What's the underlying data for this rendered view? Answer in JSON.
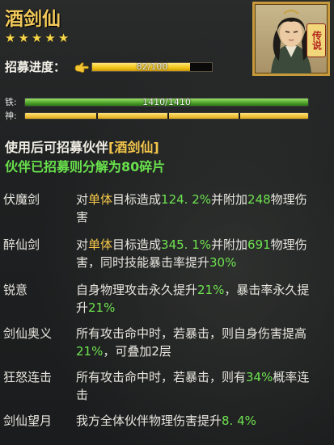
{
  "hero": {
    "name": "酒剑仙",
    "stars": 5,
    "recruit_label": "招募进度：",
    "recruit_current": 82,
    "recruit_max": 100,
    "recruit_text": "82/100",
    "badge": "传说"
  },
  "bars": {
    "hp_label": "铁:",
    "hp_text": "1410/1410",
    "hp_fraction": 1.0,
    "mp_label": "神:",
    "mp_fraction": 1.0
  },
  "info": {
    "line1_prefix": "使用后可招募伙伴",
    "line1_name": "[酒剑仙]",
    "line2": "伙伴已招募则分解为80碎片"
  },
  "skills": [
    {
      "name": "伏魔剑",
      "desc": [
        {
          "t": "对",
          "c": ""
        },
        {
          "t": "单体",
          "c": "hl"
        },
        {
          "t": "目标造成",
          "c": ""
        },
        {
          "t": "124. 2%",
          "c": "num"
        },
        {
          "t": "并附加",
          "c": ""
        },
        {
          "t": "248",
          "c": "num"
        },
        {
          "t": "物理伤害",
          "c": ""
        }
      ]
    },
    {
      "name": "醉仙剑",
      "desc": [
        {
          "t": "对",
          "c": ""
        },
        {
          "t": "单体",
          "c": "hl"
        },
        {
          "t": "目标造成",
          "c": ""
        },
        {
          "t": "345. 1%",
          "c": "num"
        },
        {
          "t": "并附加",
          "c": ""
        },
        {
          "t": "691",
          "c": "num"
        },
        {
          "t": "物理伤害，同时技能暴击率提升",
          "c": ""
        },
        {
          "t": "30%",
          "c": "num"
        }
      ]
    },
    {
      "name": "锐意",
      "desc": [
        {
          "t": "自身物理攻击永久提升",
          "c": ""
        },
        {
          "t": "21%",
          "c": "num"
        },
        {
          "t": "，暴击率永久提升",
          "c": ""
        },
        {
          "t": "21%",
          "c": "num"
        }
      ]
    },
    {
      "name": "剑仙奥义",
      "desc": [
        {
          "t": "所有攻击命中时，若暴击，则自身伤害提高",
          "c": ""
        },
        {
          "t": "21%",
          "c": "num"
        },
        {
          "t": "，可叠加2层",
          "c": ""
        }
      ]
    },
    {
      "name": "狂怒连击",
      "desc": [
        {
          "t": "所有攻击命中时，若暴击，则有",
          "c": ""
        },
        {
          "t": "34%",
          "c": "num"
        },
        {
          "t": "概率连击",
          "c": ""
        }
      ]
    },
    {
      "name": "剑仙望月",
      "desc": [
        {
          "t": "我方全体伙伴物理伤害提升",
          "c": ""
        },
        {
          "t": "8. 4%",
          "c": "num"
        }
      ]
    }
  ],
  "colors": {
    "gold": "#f2c95a",
    "green": "#6ee34f",
    "highlight": "#f4c64a"
  }
}
